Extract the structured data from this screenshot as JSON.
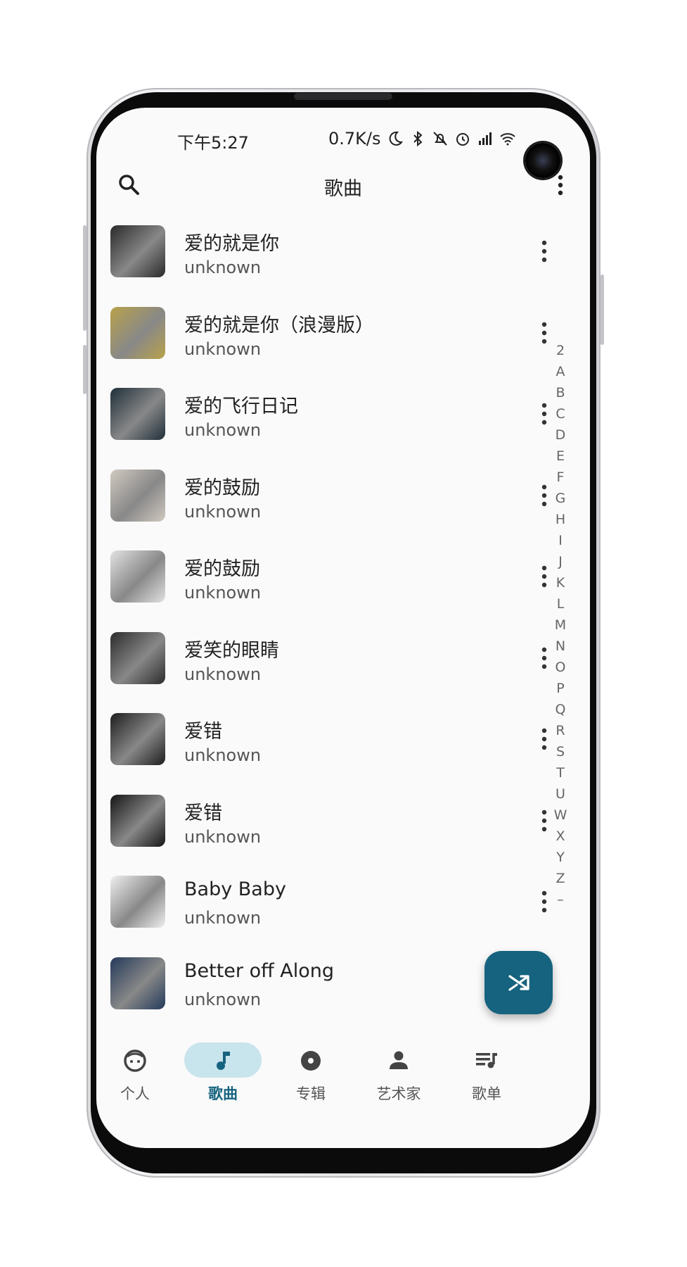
{
  "status_bar": {
    "time": "下午5:27",
    "net_speed": "0.7K/s",
    "icons": [
      "moon-icon",
      "bluetooth-icon",
      "mute-icon",
      "alarm-icon",
      "signal-icon",
      "wifi-icon",
      "battery-icon"
    ]
  },
  "app_bar": {
    "title": "歌曲",
    "search_icon": "search-icon",
    "more_icon": "more-vert-icon"
  },
  "songs": [
    {
      "title": "爱的就是你",
      "artist": "unknown",
      "cover_color": "#2a2a2a"
    },
    {
      "title": "爱的就是你（浪漫版）",
      "artist": "unknown",
      "cover_color": "#b8a24a"
    },
    {
      "title": "爱的飞行日记",
      "artist": "unknown",
      "cover_color": "#1f2f3a"
    },
    {
      "title": "爱的鼓励",
      "artist": "unknown",
      "cover_color": "#d0c9c0"
    },
    {
      "title": "爱的鼓励",
      "artist": "unknown",
      "cover_color": "#e2e2e2"
    },
    {
      "title": "爱笑的眼睛",
      "artist": "unknown",
      "cover_color": "#2c2c2c"
    },
    {
      "title": "爱错",
      "artist": "unknown",
      "cover_color": "#1e1e1e"
    },
    {
      "title": "爱错",
      "artist": "unknown",
      "cover_color": "#151515"
    },
    {
      "title": "Baby Baby",
      "artist": "unknown",
      "cover_color": "#efefef"
    },
    {
      "title": "Better off Along",
      "artist": "unknown",
      "cover_color": "#243a5a"
    }
  ],
  "alphabet": [
    "2",
    "A",
    "B",
    "C",
    "D",
    "E",
    "F",
    "G",
    "H",
    "I",
    "J",
    "K",
    "L",
    "M",
    "N",
    "O",
    "P",
    "Q",
    "R",
    "S",
    "T",
    "U",
    "W",
    "X",
    "Y",
    "Z",
    "–"
  ],
  "fab": {
    "icon": "shuffle-icon"
  },
  "bottom_nav": [
    {
      "label": "个人",
      "icon": "face-icon",
      "active": false
    },
    {
      "label": "歌曲",
      "icon": "music-note-icon",
      "active": true
    },
    {
      "label": "专辑",
      "icon": "album-icon",
      "active": false
    },
    {
      "label": "艺术家",
      "icon": "person-icon",
      "active": false
    },
    {
      "label": "歌单",
      "icon": "playlist-icon",
      "active": false
    }
  ],
  "colors": {
    "accent": "#16637f",
    "active_pill": "#c8e4ec",
    "background": "#fafafa"
  }
}
